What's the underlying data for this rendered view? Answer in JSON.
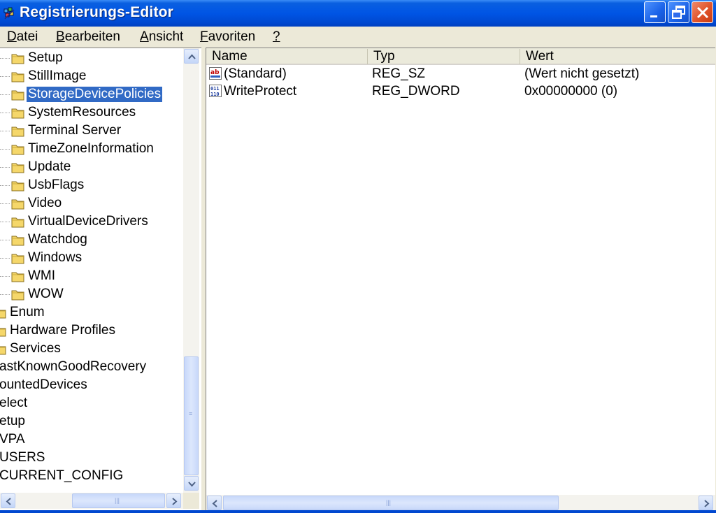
{
  "window": {
    "title": "Registrierungs-Editor"
  },
  "menu": [
    {
      "pre": "",
      "u": "D",
      "post": "atei"
    },
    {
      "pre": "",
      "u": "B",
      "post": "earbeiten"
    },
    {
      "pre": "",
      "u": "A",
      "post": "nsicht"
    },
    {
      "pre": "",
      "u": "F",
      "post": "avoriten"
    },
    {
      "pre": "",
      "u": "?",
      "post": ""
    }
  ],
  "tree": {
    "items": [
      {
        "label": "Setup"
      },
      {
        "label": "StillImage"
      },
      {
        "label": "StorageDevicePolicies",
        "selected": true
      },
      {
        "label": "SystemResources"
      },
      {
        "label": "Terminal Server"
      },
      {
        "label": "TimeZoneInformation"
      },
      {
        "label": "Update"
      },
      {
        "label": "UsbFlags"
      },
      {
        "label": "Video"
      },
      {
        "label": "VirtualDeviceDrivers"
      },
      {
        "label": "Watchdog"
      },
      {
        "label": "Windows"
      },
      {
        "label": "WMI"
      },
      {
        "label": "WOW"
      },
      {
        "label": "Enum"
      },
      {
        "label": "Hardware Profiles"
      },
      {
        "label": "Services"
      },
      {
        "label": "astKnownGoodRecovery"
      },
      {
        "label": "ountedDevices"
      },
      {
        "label": "elect"
      },
      {
        "label": "etup"
      },
      {
        "label": "VPA"
      },
      {
        "label": "USERS"
      },
      {
        "label": "CURRENT_CONFIG"
      }
    ]
  },
  "list": {
    "columns": [
      "Name",
      "Typ",
      "Wert"
    ],
    "rows": [
      {
        "icon": "string-value-icon",
        "name": "(Standard)",
        "type": "REG_SZ",
        "value": "(Wert nicht gesetzt)"
      },
      {
        "icon": "binary-value-icon",
        "name": "WriteProtect",
        "type": "REG_DWORD",
        "value": "0x00000000 (0)"
      }
    ]
  },
  "colors": {
    "titlebar": "#0055e5",
    "selection": "#316ac5",
    "chrome": "#ece9d8"
  }
}
